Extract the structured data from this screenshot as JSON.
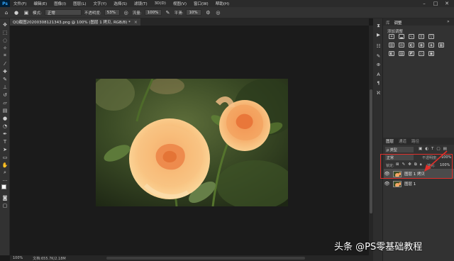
{
  "menubar": {
    "logo": "Ps",
    "items": [
      "文件(F)",
      "编辑(E)",
      "图像(I)",
      "图层(L)",
      "文字(Y)",
      "选择(S)",
      "滤镜(T)",
      "3D(D)",
      "视图(V)",
      "窗口(W)",
      "帮助(H)"
    ]
  },
  "options": {
    "mode_label": "模式:",
    "mode_value": "正常",
    "opacity_label": "不透明度:",
    "opacity_value": "53%",
    "flow_label": "流量:",
    "flow_value": "100%",
    "smooth_label": "平滑:",
    "smooth_value": "10%"
  },
  "document_tab": {
    "title": "QQ截图20200308121343.png @ 100% (图层 1 拷贝, RGB/8) *",
    "close": "×"
  },
  "status": {
    "zoom": "100%",
    "doc": "文档:655.7K/2.18M"
  },
  "right_panel": {
    "top_tabs": [
      "库",
      "调整"
    ],
    "add_adjustment": "添加调整",
    "layers_tabs": [
      "图层",
      "通道",
      "路径"
    ],
    "kind": "ρ 类型",
    "blend_mode": "正常",
    "opacity_label": "不透明度:",
    "opacity_value": "100%",
    "lock_label": "锁定:",
    "fill_label": "填充:",
    "fill_value": "100%",
    "layers": [
      {
        "name": "图层 1 拷贝",
        "selected": true
      },
      {
        "name": "图层 1",
        "selected": false
      }
    ]
  },
  "watermark": "头条 @PS零基础教程",
  "colors": {
    "accent": "#31a8ff",
    "highlight_box": "#e1302b",
    "panel": "#323232",
    "canvas": "#1b1b1b"
  },
  "icons": [
    "home-icon",
    "brush-icon",
    "move-icon",
    "marquee-icon",
    "lasso-icon",
    "crop-icon",
    "eyedropper-icon",
    "healing-icon",
    "stamp-icon",
    "eraser-icon",
    "gradient-icon",
    "pen-icon",
    "type-icon",
    "hand-icon",
    "zoom-icon",
    "eye-icon",
    "lock-icon"
  ]
}
